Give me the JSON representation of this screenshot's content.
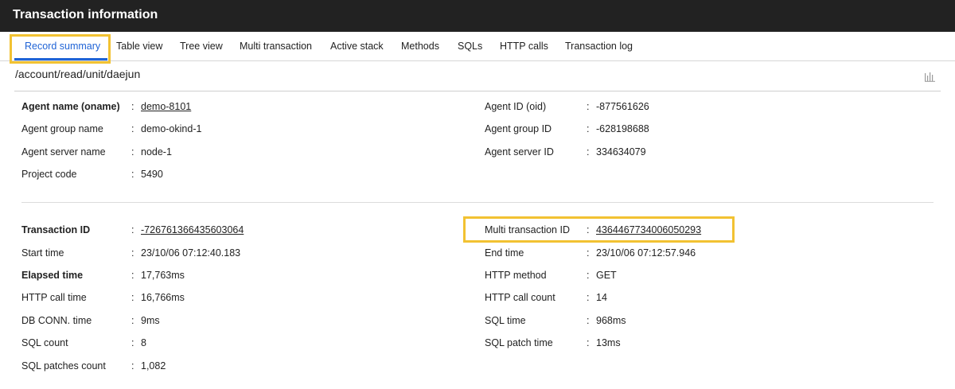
{
  "window": {
    "title": "Transaction information"
  },
  "tabs": [
    {
      "label": "Record summary",
      "active": true
    },
    {
      "label": "Table view"
    },
    {
      "label": "Tree view"
    },
    {
      "label": "Multi transaction"
    },
    {
      "label": "Active stack"
    },
    {
      "label": "Methods"
    },
    {
      "label": "SQLs"
    },
    {
      "label": "HTTP calls"
    },
    {
      "label": "Transaction log"
    }
  ],
  "path": "/account/read/unit/daejun",
  "colon": ":",
  "agent": {
    "left": [
      {
        "label": "Agent name (oname)",
        "value": "demo-8101"
      },
      {
        "label": "Agent group name",
        "value": "demo-okind-1"
      },
      {
        "label": "Agent server name",
        "value": "node-1"
      },
      {
        "label": "Project code",
        "value": "5490"
      }
    ],
    "right": [
      {
        "label": "Agent ID (oid)",
        "value": "-877561626"
      },
      {
        "label": "Agent group ID",
        "value": "-628198688"
      },
      {
        "label": "Agent server ID",
        "value": "334634079"
      }
    ]
  },
  "transaction": {
    "left": [
      {
        "label": "Transaction ID",
        "value": "-7267613664356030​64"
      },
      {
        "label": "Start time",
        "value": "23/10/06 07:12:40.183"
      },
      {
        "label": "Elapsed time",
        "value": "17,763ms"
      },
      {
        "label": "HTTP call time",
        "value": "16,766ms"
      },
      {
        "label": "DB CONN. time",
        "value": "9ms"
      },
      {
        "label": "SQL count",
        "value": "8"
      },
      {
        "label": "SQL patches count",
        "value": "1,082"
      }
    ],
    "right": [
      {
        "label": "Multi transaction ID",
        "value": "4364467734006050293"
      },
      {
        "label": "End time",
        "value": "23/10/06 07:12:57.946"
      },
      {
        "label": "HTTP method",
        "value": "GET"
      },
      {
        "label": "HTTP call count",
        "value": "14"
      },
      {
        "label": "SQL time",
        "value": "968ms"
      },
      {
        "label": "SQL patch time",
        "value": "13ms"
      }
    ]
  },
  "icons": {
    "chart": "bar-chart-icon"
  },
  "colors": {
    "accent": "#1f63d6",
    "highlight": "#f2c232",
    "titlebar": "#222222"
  }
}
